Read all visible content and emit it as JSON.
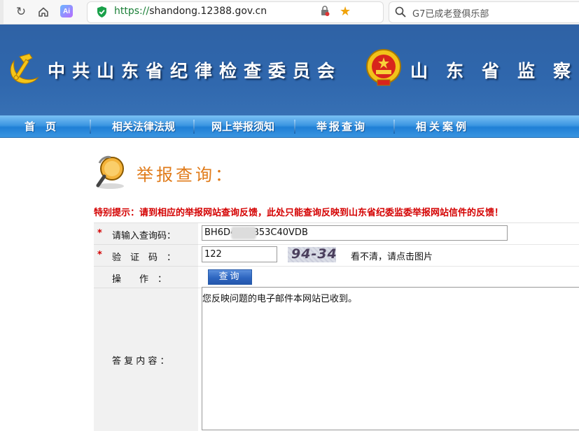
{
  "browser": {
    "url_scheme": "https://",
    "url_host": "shandong.12388.gov.cn",
    "ai_badge": "Ai",
    "search_text": "G7已成老登俱乐部"
  },
  "banner": {
    "title": "中共山东省纪律检查委员会",
    "title2": "山东省监察"
  },
  "nav": {
    "items": [
      "首　页",
      "相关法律法规",
      "网上举报须知",
      "举报查询",
      "相关案例"
    ]
  },
  "page": {
    "title": "举报查询：",
    "notice": "特别提示：请到相应的举报网站查询反馈，此处只能查询反映到山东省纪委监委举报网站信件的反馈！"
  },
  "form": {
    "required_mark": "*",
    "code_label": "请输入查询码：",
    "code_value": "BH6D4      4FJB53C40VDB",
    "captcha_label": "验　证　码　：",
    "captcha_value": "122",
    "captcha_image_text": "94-34",
    "captcha_hint": "看不清，请点击图片",
    "action_label": "操　　作　：",
    "query_button": "查询",
    "reply_label": "答 复 内 容 ：",
    "reply_text": "您反映问题的电子邮件本网站已收到。"
  },
  "colors": {
    "banner_blue": "#2f67ad",
    "nav_blue": "#3d97e2",
    "title_orange": "#e07b1a",
    "notice_red": "#d40000"
  }
}
